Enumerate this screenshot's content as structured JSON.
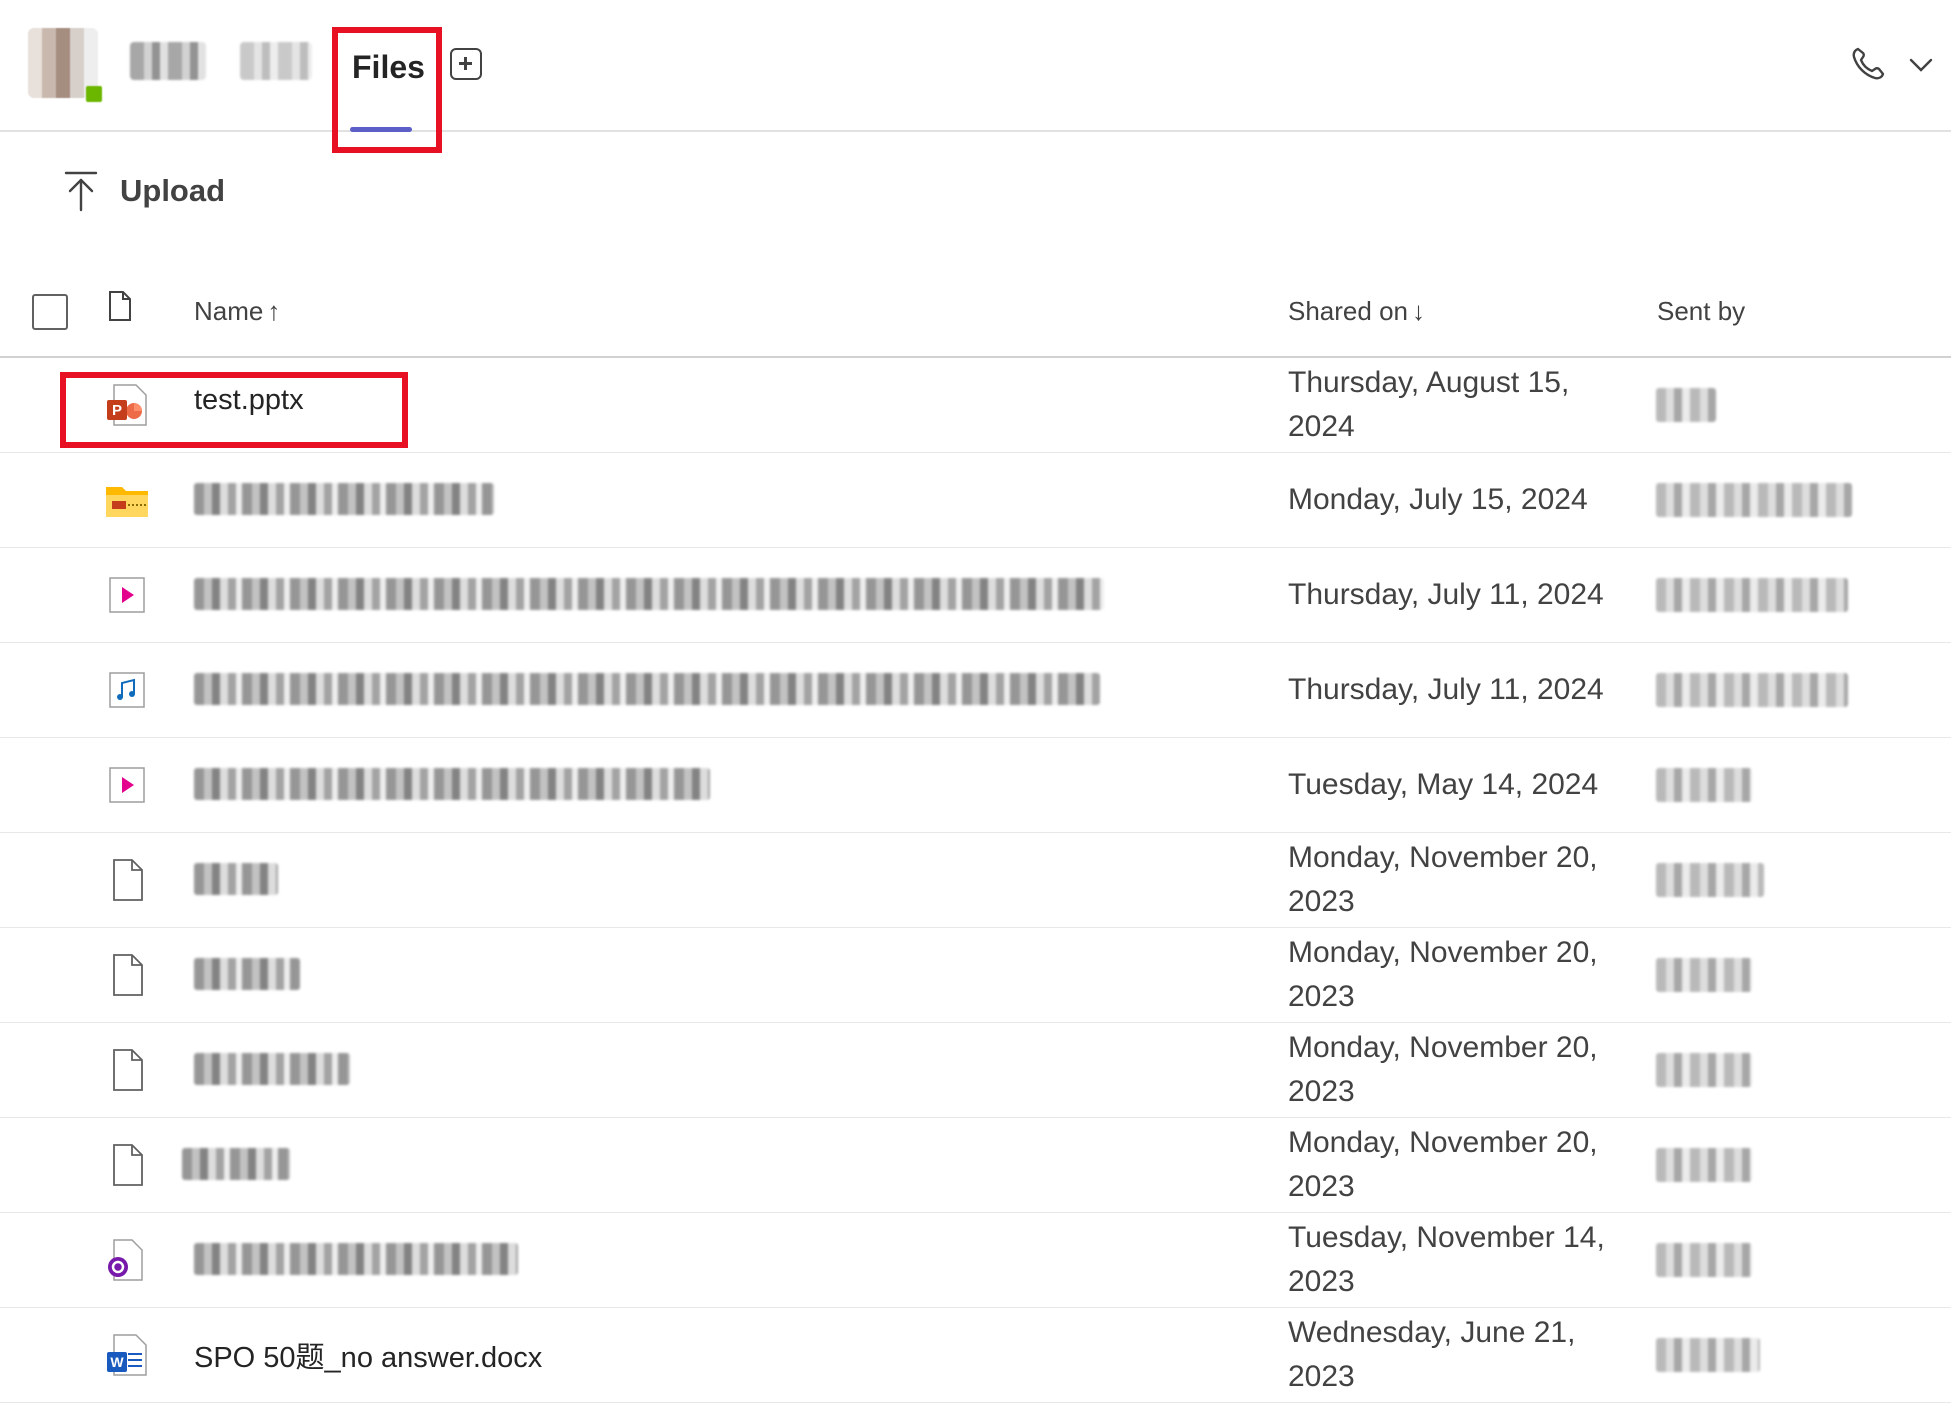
{
  "header": {
    "active_tab": "Files",
    "add_tab_label": "+",
    "accent_color": "#5b5fc7",
    "highlight_color": "#e81123"
  },
  "toolbar": {
    "upload_label": "Upload"
  },
  "table": {
    "columns": {
      "name": "Name",
      "shared_on": "Shared on",
      "sent_by": "Sent by"
    },
    "sort": {
      "name": "↑",
      "shared_on": "↓"
    },
    "rows": [
      {
        "icon": "powerpoint-icon",
        "name": "test.pptx",
        "shared_on": "Thursday, August 15, 2024"
      },
      {
        "icon": "zip-folder-icon",
        "name": "",
        "shared_on": "Monday, July 15, 2024"
      },
      {
        "icon": "video-file-icon",
        "name": "",
        "shared_on": "Thursday, July 11, 2024"
      },
      {
        "icon": "audio-file-icon",
        "name": "",
        "shared_on": "Thursday, July 11, 2024"
      },
      {
        "icon": "video-file-icon",
        "name": "",
        "shared_on": "Tuesday, May 14, 2024"
      },
      {
        "icon": "generic-file-icon",
        "name": "",
        "shared_on": "Monday, November 20, 2023"
      },
      {
        "icon": "generic-file-icon",
        "name": "",
        "shared_on": "Monday, November 20, 2023"
      },
      {
        "icon": "generic-file-icon",
        "name": "",
        "shared_on": "Monday, November 20, 2023"
      },
      {
        "icon": "generic-file-icon",
        "name": "",
        "shared_on": "Monday, November 20, 2023"
      },
      {
        "icon": "loop-file-icon",
        "name": "",
        "shared_on": "Tuesday, November 14, 2023"
      },
      {
        "icon": "word-icon",
        "name": "SPO 50题_no answer.docx",
        "shared_on": "Wednesday, June 21, 2023"
      }
    ]
  }
}
